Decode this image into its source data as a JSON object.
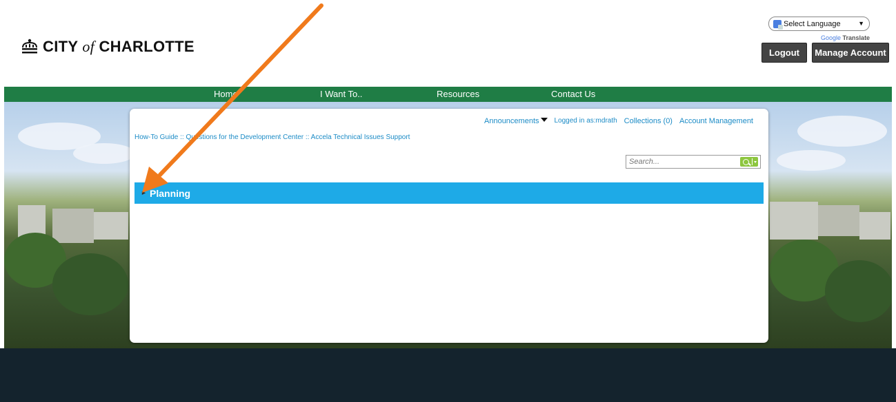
{
  "header": {
    "logo_city": "CITY",
    "logo_of": "of",
    "logo_name": "CHARLOTTE",
    "language_select": "Select Language",
    "powered_by": "Google",
    "translate": "Translate",
    "logout": "Logout",
    "manage_account": "Manage Account"
  },
  "nav": {
    "items": [
      "Home",
      "I Want To..",
      "Resources",
      "Contact Us"
    ]
  },
  "card": {
    "announcements": "Announcements",
    "logged_in": "Logged in as:mdrath",
    "collections": "Collections (0)",
    "account_management": "Account Management",
    "breadcrumb": "How-To Guide :: Questions for the Development Center :: Accela Technical Issues Support",
    "search_placeholder": "Search...",
    "section_title": "Planning"
  },
  "colors": {
    "nav": "#1f7d45",
    "section": "#1eaae7",
    "arrow": "#f07a1c",
    "footer": "#14232d"
  }
}
